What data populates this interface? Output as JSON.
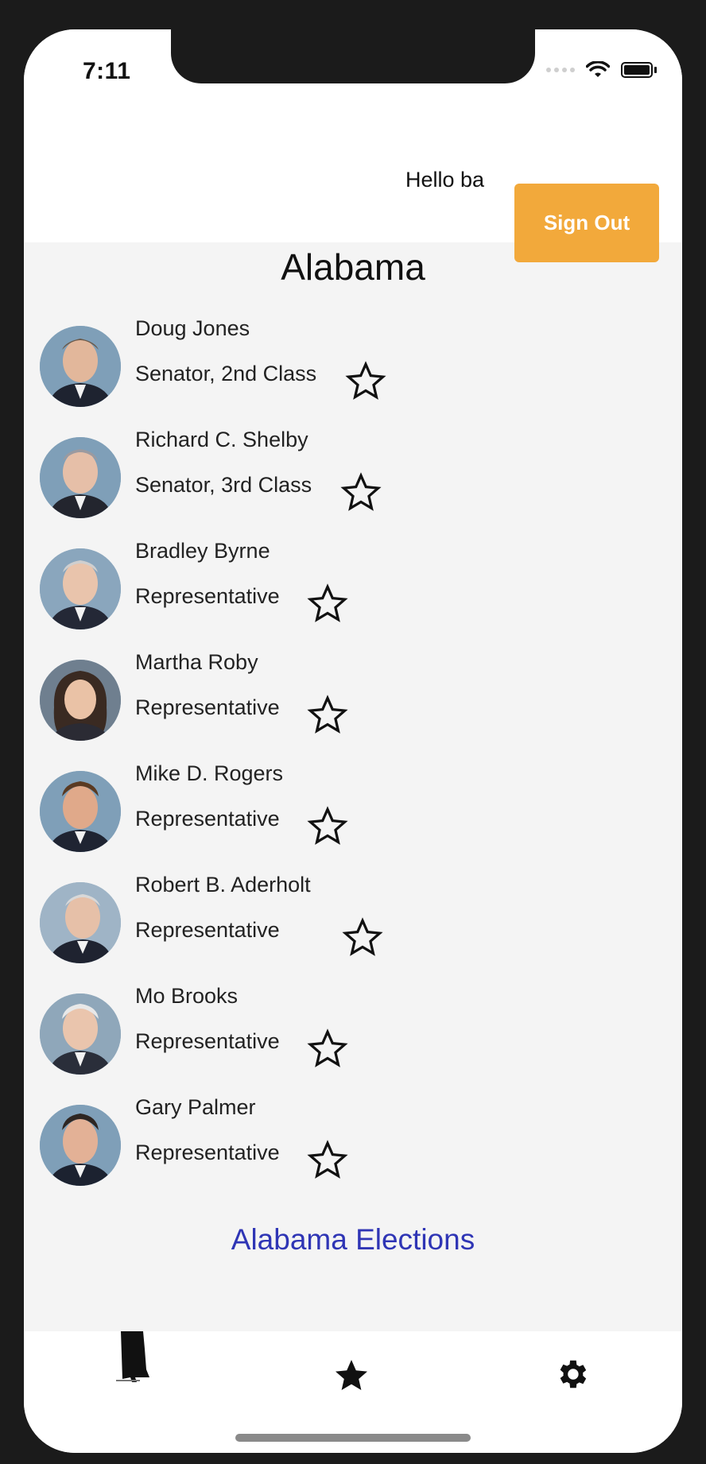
{
  "status_bar": {
    "time": "7:11"
  },
  "header": {
    "greeting": "Hello ba",
    "sign_out_label": "Sign Out"
  },
  "state_title": "Alabama",
  "representatives": [
    {
      "name": "Doug Jones",
      "title": "Senator, 2nd Class",
      "favorited": false
    },
    {
      "name": "Richard C. Shelby",
      "title": "Senator, 3rd Class",
      "favorited": false
    },
    {
      "name": "Bradley Byrne",
      "title": "Representative",
      "favorited": false
    },
    {
      "name": "Martha Roby",
      "title": "Representative",
      "favorited": false
    },
    {
      "name": "Mike D. Rogers",
      "title": "Representative",
      "favorited": false
    },
    {
      "name": "Robert B. Aderholt",
      "title": "Representative",
      "favorited": false
    },
    {
      "name": "Mo Brooks",
      "title": "Representative",
      "favorited": false
    },
    {
      "name": "Gary Palmer",
      "title": "Representative",
      "favorited": false
    }
  ],
  "elections_link": "Alabama Elections",
  "tab_bar": {
    "tabs": [
      {
        "icon": "alabama-state-icon"
      },
      {
        "icon": "star-icon"
      },
      {
        "icon": "gear-icon"
      }
    ]
  },
  "colors": {
    "accent": "#f2a93b",
    "link": "#2f35b5"
  }
}
